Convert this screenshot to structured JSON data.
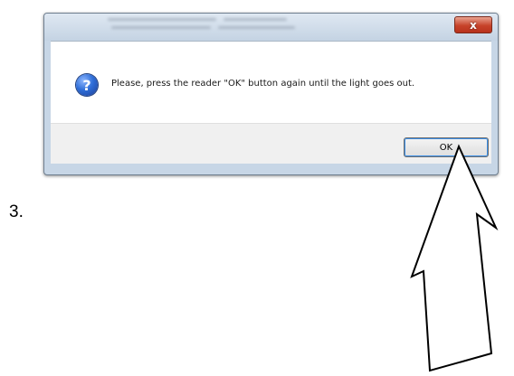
{
  "step": {
    "number": "3."
  },
  "dialog": {
    "close_glyph": "x",
    "icon_glyph": "?",
    "message": "Please, press the reader \"OK\" button again until the light goes out.",
    "ok_label": "OK"
  },
  "annotation": {
    "icon": "arrow-up-icon"
  },
  "colors": {
    "close_button": "#c7432a",
    "icon_blue": "#2f6ed8",
    "footer": "#f0f0f0"
  }
}
